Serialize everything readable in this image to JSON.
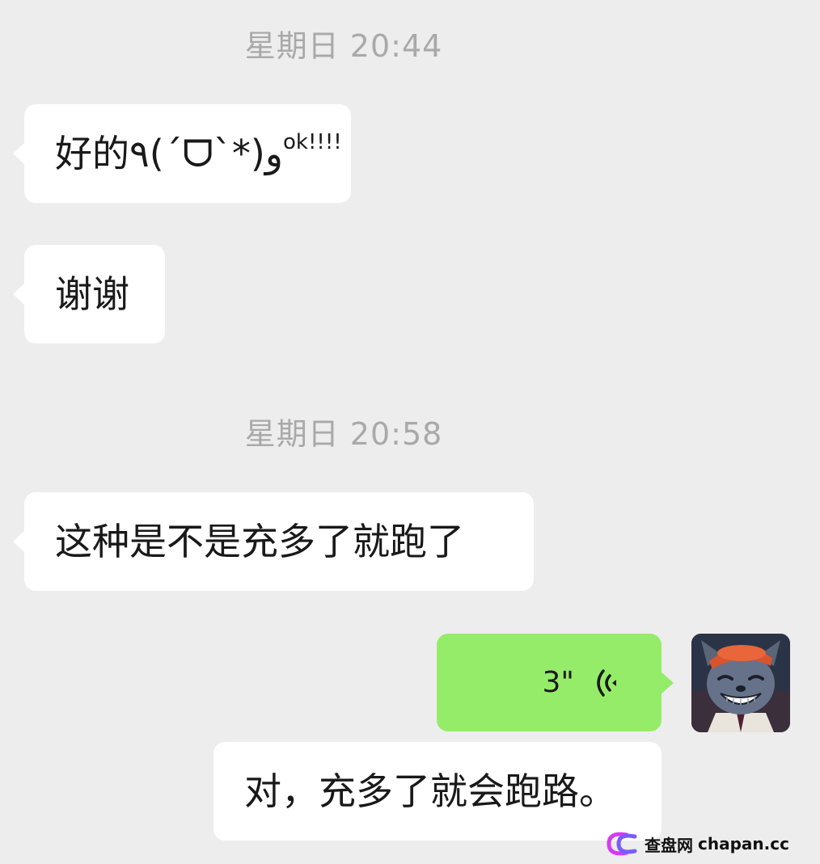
{
  "messages": {
    "time1": "星期日 20:44",
    "msg1_main": "好的٩(ˊᗜˋ*)و",
    "msg1_sup": "ok!!!!",
    "msg2": "谢谢",
    "time2": "星期日 20:58",
    "msg3": "这种是不是充多了就跑了",
    "voice_duration": "3\"",
    "transcript": "对，充多了就会跑路。"
  },
  "watermark": {
    "brand": "查盘网",
    "url": "chapan.cc"
  },
  "colors": {
    "background": "#ededed",
    "bubble_incoming": "#ffffff",
    "bubble_outgoing": "#95ec69",
    "timestamp": "#a9a9a9"
  },
  "icons": {
    "voice": "voice-wave-icon",
    "avatar": "cartoon-wolf-avatar"
  }
}
